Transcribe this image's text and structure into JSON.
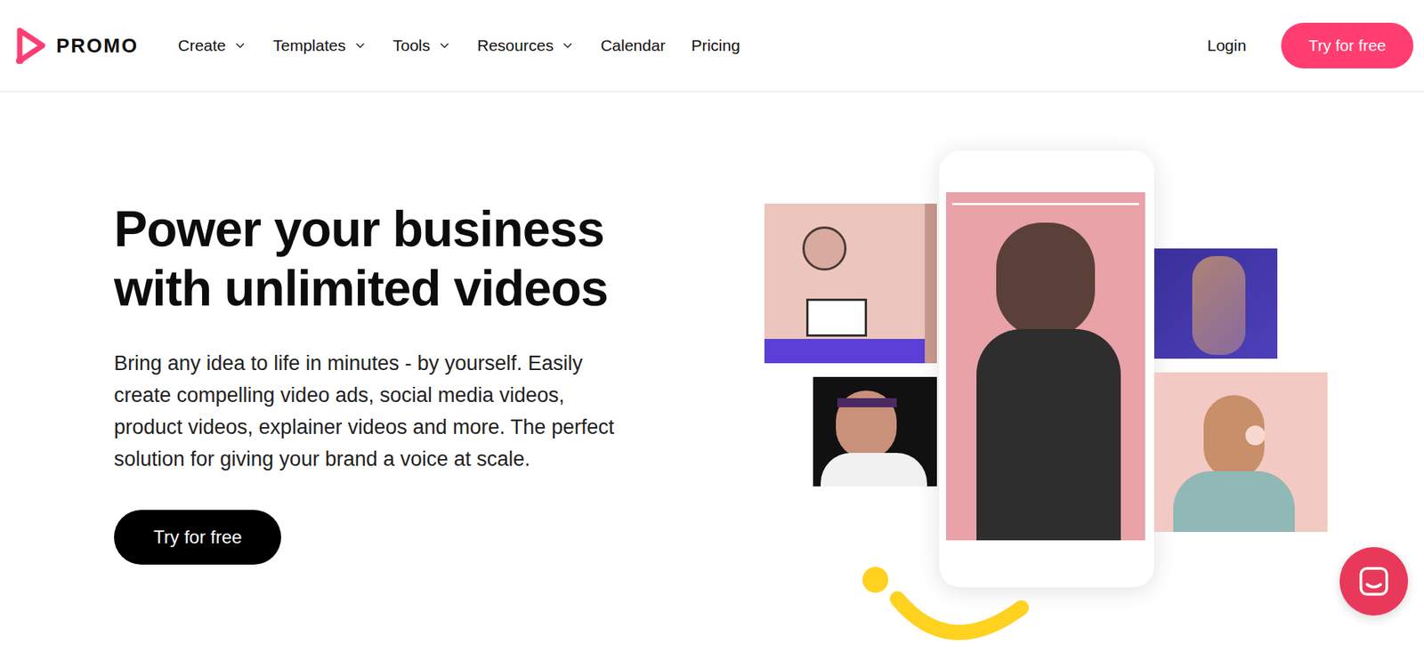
{
  "header": {
    "logo": "PROMO",
    "nav": [
      {
        "label": "Create",
        "kind": "dropdown"
      },
      {
        "label": "Templates",
        "kind": "dropdown"
      },
      {
        "label": "Tools",
        "kind": "dropdown"
      },
      {
        "label": "Resources",
        "kind": "dropdown"
      },
      {
        "label": "Calendar",
        "kind": "link"
      },
      {
        "label": "Pricing",
        "kind": "link"
      }
    ],
    "login": "Login",
    "cta": "Try for free"
  },
  "hero": {
    "title_lines": [
      "Power your business",
      "with unlimited videos"
    ],
    "description": "Bring any idea to life in minutes - by yourself. Easily create compelling video ads, social media videos, product videos, explainer videos and more. The perfect solution for giving your brand a voice at scale.",
    "cta": "Try for free"
  }
}
